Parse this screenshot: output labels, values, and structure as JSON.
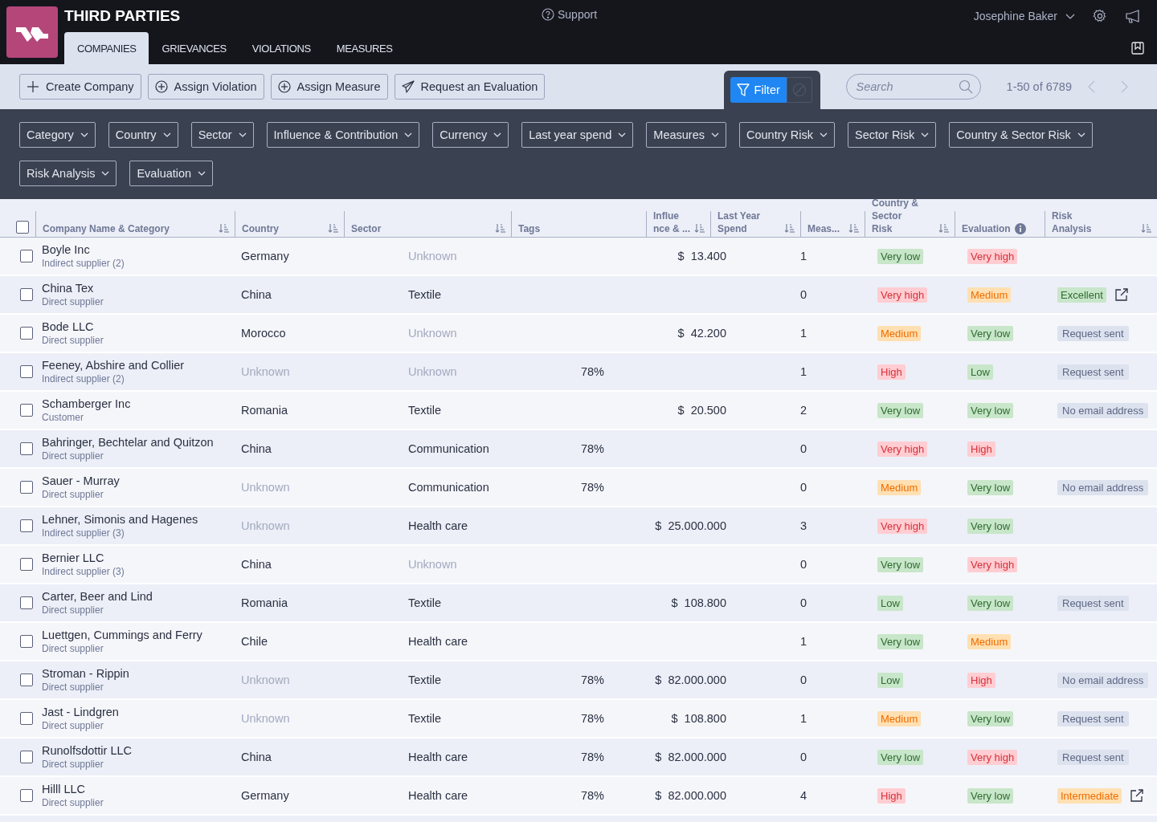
{
  "app": {
    "title": "THIRD PARTIES",
    "support": "Support",
    "user": "Josephine Baker"
  },
  "tabs": [
    {
      "label": "COMPANIES",
      "selected": true
    },
    {
      "label": "GRIEVANCES",
      "selected": false
    },
    {
      "label": "VIOLATIONS",
      "selected": false
    },
    {
      "label": "MEASURES",
      "selected": false
    }
  ],
  "actions": [
    {
      "label": "Create Company",
      "kind": "plus"
    },
    {
      "label": "Assign Violation",
      "kind": "circle-plus"
    },
    {
      "label": "Assign Measure",
      "kind": "circle-plus"
    },
    {
      "label": "Request an Evaluation",
      "kind": "send"
    }
  ],
  "filter_button": "Filter",
  "search": {
    "placeholder": "Search"
  },
  "pagination": "1-50 of 6789",
  "filters": [
    "Category",
    "Country",
    "Sector",
    "Influence & Contribution",
    "Currency",
    "Last year spend",
    "Measures",
    "Country Risk",
    "Sector Risk",
    "Country & Sector Risk",
    "Risk Analysis",
    "Evaluation"
  ],
  "columns": [
    {
      "label": "Company Name & Category",
      "sortable": true
    },
    {
      "label": "Country",
      "sortable": true
    },
    {
      "label": "Sector",
      "sortable": true
    },
    {
      "label": "Tags",
      "sortable": false
    },
    {
      "label": "Influe nce & ...",
      "sortable": true
    },
    {
      "label": "Last Year Spend",
      "sortable": true
    },
    {
      "label": "Meas...",
      "sortable": true
    },
    {
      "label": "Country & Sector Risk",
      "sortable": true
    },
    {
      "label": "Evaluation",
      "sortable": false,
      "info": true
    },
    {
      "label": "Risk Analysis",
      "sortable": true
    }
  ],
  "select_all": {
    "checked": false
  },
  "rows": [
    {
      "checked": false,
      "name": "Boyle Inc",
      "category": "Indirect supplier (2)",
      "country": {
        "text": "Germany",
        "muted": false
      },
      "sector": {
        "text": "Unknown",
        "muted": true
      },
      "influence": "",
      "spend": "$  13.400",
      "measures": "1",
      "risk": {
        "text": "Very low",
        "kind": "good"
      },
      "evaluation": {
        "text": "Very high",
        "kind": "bad"
      }
    },
    {
      "checked": false,
      "name": "China Tex",
      "category": "Direct supplier",
      "country": {
        "text": "China",
        "muted": false
      },
      "sector": {
        "text": "Textile",
        "muted": false
      },
      "influence": "",
      "spend": "",
      "measures": "0",
      "risk": {
        "text": "Very high",
        "kind": "bad"
      },
      "evaluation": {
        "text": "Medium",
        "kind": "warn"
      },
      "analysis": {
        "text": "Excellent",
        "kind": "good",
        "link": true
      }
    },
    {
      "checked": false,
      "name": "Bode LLC",
      "category": "Direct supplier",
      "country": {
        "text": "Morocco",
        "muted": false
      },
      "sector": {
        "text": "Unknown",
        "muted": true
      },
      "influence": "",
      "spend": "$  42.200",
      "measures": "1",
      "risk": {
        "text": "Medium",
        "kind": "warn"
      },
      "evaluation": {
        "text": "Very low",
        "kind": "good"
      },
      "analysis": {
        "text": "Request sent",
        "kind": "neutral",
        "link": false
      }
    },
    {
      "checked": false,
      "name": "Feeney, Abshire and Collier",
      "category": "Indirect supplier (2)",
      "country": {
        "text": "Unknown",
        "muted": true
      },
      "sector": {
        "text": "Unknown",
        "muted": true
      },
      "influence": "78%",
      "spend": "",
      "measures": "1",
      "risk": {
        "text": "High",
        "kind": "bad"
      },
      "evaluation": {
        "text": "Low",
        "kind": "good"
      },
      "analysis": {
        "text": "Request sent",
        "kind": "neutral",
        "link": false
      }
    },
    {
      "checked": false,
      "name": "Schamberger Inc",
      "category": "Customer",
      "country": {
        "text": "Romania",
        "muted": false
      },
      "sector": {
        "text": "Textile",
        "muted": false
      },
      "influence": "",
      "spend": "$  20.500",
      "measures": "2",
      "risk": {
        "text": "Very low",
        "kind": "good"
      },
      "evaluation": {
        "text": "Very low",
        "kind": "good"
      },
      "analysis": {
        "text": "No email address",
        "kind": "neutral",
        "link": false
      }
    },
    {
      "checked": false,
      "name": "Bahringer, Bechtelar and Quitzon",
      "category": "Direct supplier",
      "country": {
        "text": "China",
        "muted": false
      },
      "sector": {
        "text": "Communication",
        "muted": false
      },
      "influence": "78%",
      "spend": "",
      "measures": "0",
      "risk": {
        "text": "Very high",
        "kind": "bad"
      },
      "evaluation": {
        "text": "High",
        "kind": "bad"
      }
    },
    {
      "checked": false,
      "name": "Sauer - Murray",
      "category": "Direct supplier",
      "country": {
        "text": "Unknown",
        "muted": true
      },
      "sector": {
        "text": "Communication",
        "muted": false
      },
      "influence": "78%",
      "spend": "",
      "measures": "0",
      "risk": {
        "text": "Medium",
        "kind": "warn"
      },
      "evaluation": {
        "text": "Very low",
        "kind": "good"
      },
      "analysis": {
        "text": "No email address",
        "kind": "neutral",
        "link": false
      }
    },
    {
      "checked": false,
      "name": "Lehner, Simonis and Hagenes",
      "category": "Indirect supplier (3)",
      "country": {
        "text": "Unknown",
        "muted": true
      },
      "sector": {
        "text": "Health care",
        "muted": false
      },
      "influence": "",
      "spend": "$  25.000.000",
      "measures": "3",
      "risk": {
        "text": "Very high",
        "kind": "bad"
      },
      "evaluation": {
        "text": "Very low",
        "kind": "good"
      }
    },
    {
      "checked": false,
      "name": "Bernier LLC",
      "category": "Indirect supplier (3)",
      "country": {
        "text": "China",
        "muted": false
      },
      "sector": {
        "text": "Unknown",
        "muted": true
      },
      "influence": "",
      "spend": "",
      "measures": "0",
      "risk": {
        "text": "Very low",
        "kind": "good"
      },
      "evaluation": {
        "text": "Very high",
        "kind": "bad"
      }
    },
    {
      "checked": false,
      "name": "Carter, Beer and Lind",
      "category": "Direct supplier",
      "country": {
        "text": "Romania",
        "muted": false
      },
      "sector": {
        "text": "Textile",
        "muted": false
      },
      "influence": "",
      "spend": "$  108.800",
      "measures": "0",
      "risk": {
        "text": "Low",
        "kind": "good"
      },
      "evaluation": {
        "text": "Very low",
        "kind": "good"
      },
      "analysis": {
        "text": "Request sent",
        "kind": "neutral",
        "link": false
      }
    },
    {
      "checked": false,
      "name": "Luettgen, Cummings and Ferry",
      "category": "Direct supplier",
      "country": {
        "text": "Chile",
        "muted": false
      },
      "sector": {
        "text": "Health care",
        "muted": false
      },
      "influence": "",
      "spend": "",
      "measures": "1",
      "risk": {
        "text": "Very low",
        "kind": "good"
      },
      "evaluation": {
        "text": "Medium",
        "kind": "warn"
      }
    },
    {
      "checked": false,
      "name": "Stroman - Rippin",
      "category": "Direct supplier",
      "country": {
        "text": "Unknown",
        "muted": true
      },
      "sector": {
        "text": "Textile",
        "muted": false
      },
      "influence": "78%",
      "spend": "$  82.000.000",
      "measures": "0",
      "risk": {
        "text": "Low",
        "kind": "good"
      },
      "evaluation": {
        "text": "High",
        "kind": "bad"
      },
      "analysis": {
        "text": "No email address",
        "kind": "neutral",
        "link": false
      }
    },
    {
      "checked": false,
      "name": "Jast - Lindgren",
      "category": "Direct supplier",
      "country": {
        "text": "Unknown",
        "muted": true
      },
      "sector": {
        "text": "Textile",
        "muted": false
      },
      "influence": "78%",
      "spend": "$  108.800",
      "measures": "1",
      "risk": {
        "text": "Medium",
        "kind": "warn"
      },
      "evaluation": {
        "text": "Very low",
        "kind": "good"
      },
      "analysis": {
        "text": "Request sent",
        "kind": "neutral",
        "link": false
      }
    },
    {
      "checked": false,
      "name": "Runolfsdottir LLC",
      "category": "Direct supplier",
      "country": {
        "text": "China",
        "muted": false
      },
      "sector": {
        "text": "Health care",
        "muted": false
      },
      "influence": "78%",
      "spend": "$  82.000.000",
      "measures": "0",
      "risk": {
        "text": "Very low",
        "kind": "good"
      },
      "evaluation": {
        "text": "Very high",
        "kind": "bad"
      },
      "analysis": {
        "text": "Request sent",
        "kind": "neutral",
        "link": false
      }
    },
    {
      "checked": false,
      "name": "Hilll LLC",
      "category": "Direct supplier",
      "country": {
        "text": "Germany",
        "muted": false
      },
      "sector": {
        "text": "Health care",
        "muted": false
      },
      "influence": "78%",
      "spend": "$  82.000.000",
      "measures": "4",
      "risk": {
        "text": "High",
        "kind": "bad"
      },
      "evaluation": {
        "text": "Very low",
        "kind": "good"
      },
      "analysis": {
        "text": "Intermediate",
        "kind": "warn",
        "link": true
      }
    }
  ]
}
